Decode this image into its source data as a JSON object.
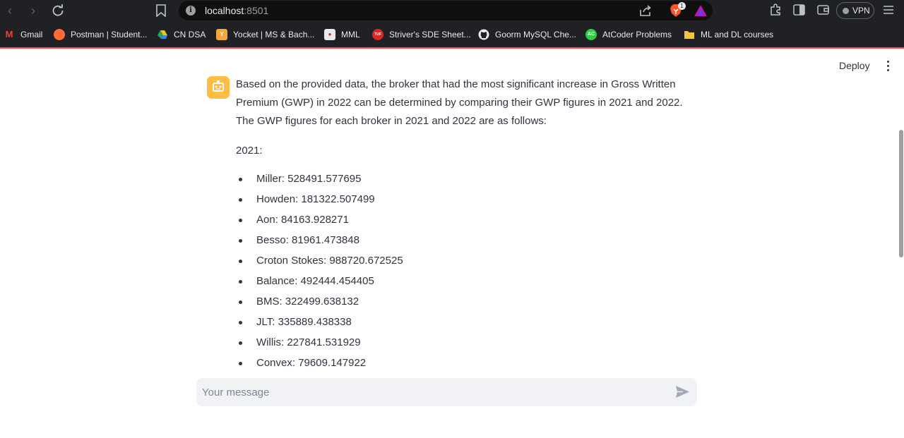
{
  "browser": {
    "url_host": "localhost",
    "url_port": ":8501",
    "brave_badge": "1",
    "vpn_label": "VPN"
  },
  "bookmarks": [
    {
      "label": "Gmail",
      "icon": "gmail-icon",
      "color": "#ea4335"
    },
    {
      "label": "Postman | Student...",
      "icon": "postman-icon",
      "color": "#ff6c37"
    },
    {
      "label": "CN DSA",
      "icon": "google-drive-icon",
      "color": "#1fa463"
    },
    {
      "label": "Yocket | MS & Bach...",
      "icon": "yocket-icon",
      "color": "#f7a738"
    },
    {
      "label": "MML",
      "icon": "mml-icon",
      "color": "#e8eaed"
    },
    {
      "label": "Striver's SDE Sheet...",
      "icon": "tuf-icon",
      "color": "#d62828"
    },
    {
      "label": "Goorm MySQL Che...",
      "icon": "github-icon",
      "color": "#e8eaed"
    },
    {
      "label": "AtCoder Problems",
      "icon": "atcoder-icon",
      "color": "#2ecc40"
    },
    {
      "label": "ML and DL courses",
      "icon": "folder-icon",
      "color": "#f4c542"
    }
  ],
  "app": {
    "deploy_label": "Deploy"
  },
  "message": {
    "intro": "Based on the provided data, the broker that had the most significant increase in Gross Written Premium (GWP) in 2022 can be determined by comparing their GWP figures in 2021 and 2022. The GWP figures for each broker in 2021 and 2022 are as follows:",
    "year_heading": "2021:",
    "items": [
      "Miller: 528491.577695",
      "Howden: 181322.507499",
      "Aon: 84163.928271",
      "Besso: 81961.473848",
      "Croton Stokes: 988720.672525",
      "Balance: 492444.454405",
      "BMS: 322499.638132",
      "JLT: 335889.438338",
      "Willis: 227841.531929",
      "Convex: 79609.147922"
    ]
  },
  "chat_input": {
    "placeholder": "Your message"
  },
  "colors": {
    "accent": "#ff4b4b",
    "avatar": "#ffbd45",
    "text": "#31333f"
  }
}
